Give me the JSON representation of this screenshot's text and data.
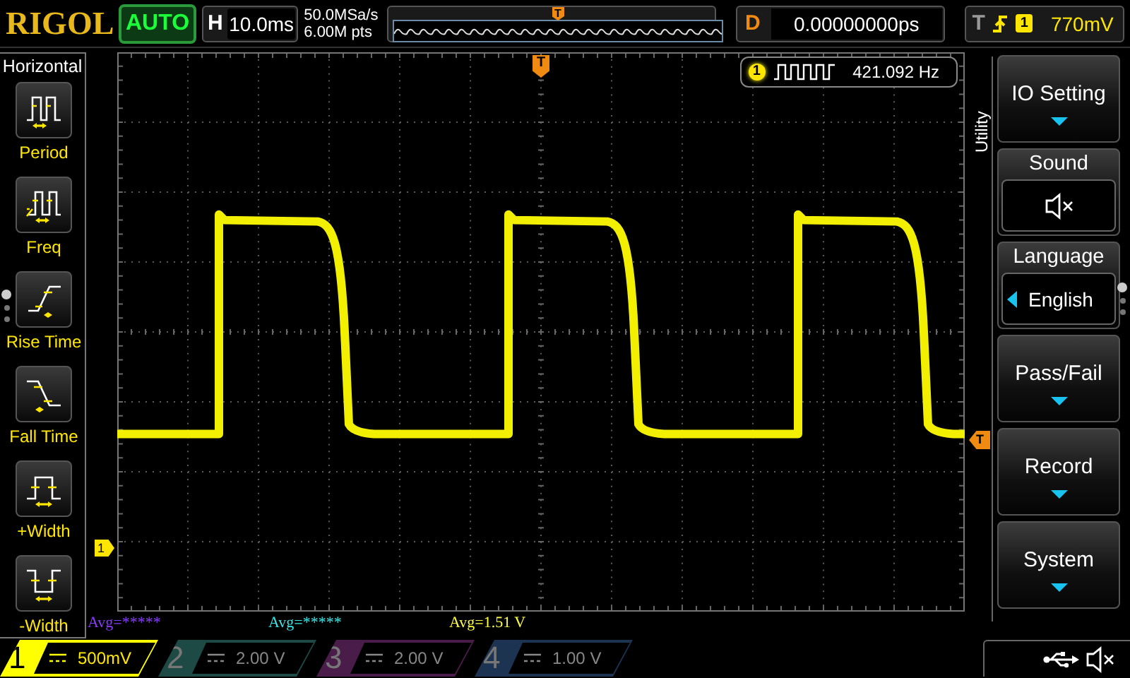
{
  "top_bar": {
    "logo": "RIGOL",
    "run_mode": "AUTO",
    "timebase": {
      "label": "H",
      "value": "10.0ms"
    },
    "sample_rate": "50.0MSa/s",
    "memory_depth": "6.00M pts",
    "overview_marker": "T",
    "delay": {
      "label": "D",
      "value": "0.00000000ps"
    },
    "trigger": {
      "label": "T",
      "rising_edge": true,
      "channel": "1",
      "level": "770mV"
    }
  },
  "left_menu": {
    "title": "Horizontal",
    "items": [
      {
        "label": "Period",
        "kind": "period"
      },
      {
        "label": "Freq",
        "kind": "freq"
      },
      {
        "label": "Rise Time",
        "kind": "rise"
      },
      {
        "label": "Fall Time",
        "kind": "fall"
      },
      {
        "label": "+Width",
        "kind": "pwidth"
      },
      {
        "label": "-Width",
        "kind": "nwidth"
      }
    ],
    "pages": [
      {
        "selected": true
      },
      {
        "selected": false
      },
      {
        "selected": false
      }
    ]
  },
  "screen": {
    "trigger_position_marker": "T",
    "ground_marker": "1",
    "trigger_level_marker": "T",
    "measurement": {
      "channel": "1",
      "value": "421.092 Hz"
    }
  },
  "averages": [
    {
      "text": "Avg=*****",
      "color": "#8a3cff"
    },
    {
      "text": "Avg=*****",
      "color": "#3ce6e6"
    },
    {
      "text": "Avg=1.51 V",
      "color": "#ffff40"
    }
  ],
  "right_menu": {
    "title": "Utility",
    "items": [
      {
        "label": "IO Setting",
        "kind": "submenu"
      },
      {
        "label": "Sound",
        "kind": "switch",
        "on": false
      },
      {
        "label": "Language",
        "kind": "select",
        "value": "English"
      },
      {
        "label": "Pass/Fail",
        "kind": "submenu"
      },
      {
        "label": "Record",
        "kind": "submenu"
      },
      {
        "label": "System",
        "kind": "submenu"
      }
    ],
    "pages": [
      {
        "selected": true
      },
      {
        "selected": false
      },
      {
        "selected": false
      }
    ]
  },
  "channels": [
    {
      "number": "1",
      "scale": "500mV",
      "on": true,
      "color": "#ffff00"
    },
    {
      "number": "2",
      "scale": "2.00 V",
      "on": false,
      "color": "#1d4a45"
    },
    {
      "number": "3",
      "scale": "2.00 V",
      "on": false,
      "color": "#4a1c4a"
    },
    {
      "number": "4",
      "scale": "1.00 V",
      "on": false,
      "color": "#1c3352"
    }
  ]
}
